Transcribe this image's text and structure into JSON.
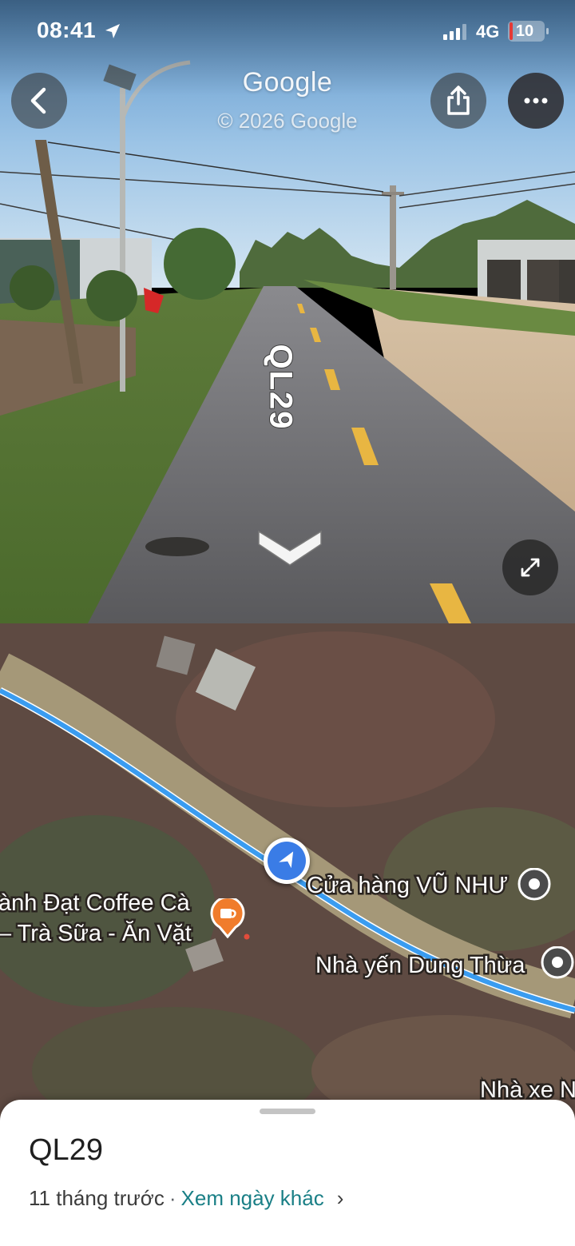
{
  "status_bar": {
    "time": "08:41",
    "network": "4G",
    "battery_level": "10",
    "battery_fraction": 0.1,
    "location_icon": "location-arrow-icon",
    "signal_icon": "cellular-signal-icon"
  },
  "street_view": {
    "brand": "Google",
    "copyright": "© 2026 Google",
    "road_label": "QL29",
    "back_icon": "chevron-left-icon",
    "share_icon": "share-icon",
    "more_icon": "more-horizontal-icon",
    "expand_icon": "expand-icon",
    "navigate_icon": "chevron-down-icon"
  },
  "map": {
    "pois": [
      {
        "label": "Cửa hàng VŨ NHƯ",
        "icon": "place-pin-icon"
      },
      {
        "label": "ành Đạt Coffee Cà",
        "icon": "coffee-pin-icon"
      },
      {
        "label": "– Trà Sữa - Ăn Vặt",
        "icon": ""
      },
      {
        "label": "Nhà yến Dung Thừa",
        "icon": "place-pin-icon"
      },
      {
        "label": "Nhà xe N",
        "icon": ""
      }
    ],
    "route_color": "#3a9cf0",
    "location_icon": "navigation-arrow-icon"
  },
  "sheet": {
    "title": "QL29",
    "age": "11 tháng trước",
    "separator": "·",
    "link": "Xem ngày khác",
    "chevron": "›"
  },
  "colors": {
    "accent_link": "#1a7f86",
    "battery_low": "#e53935"
  }
}
